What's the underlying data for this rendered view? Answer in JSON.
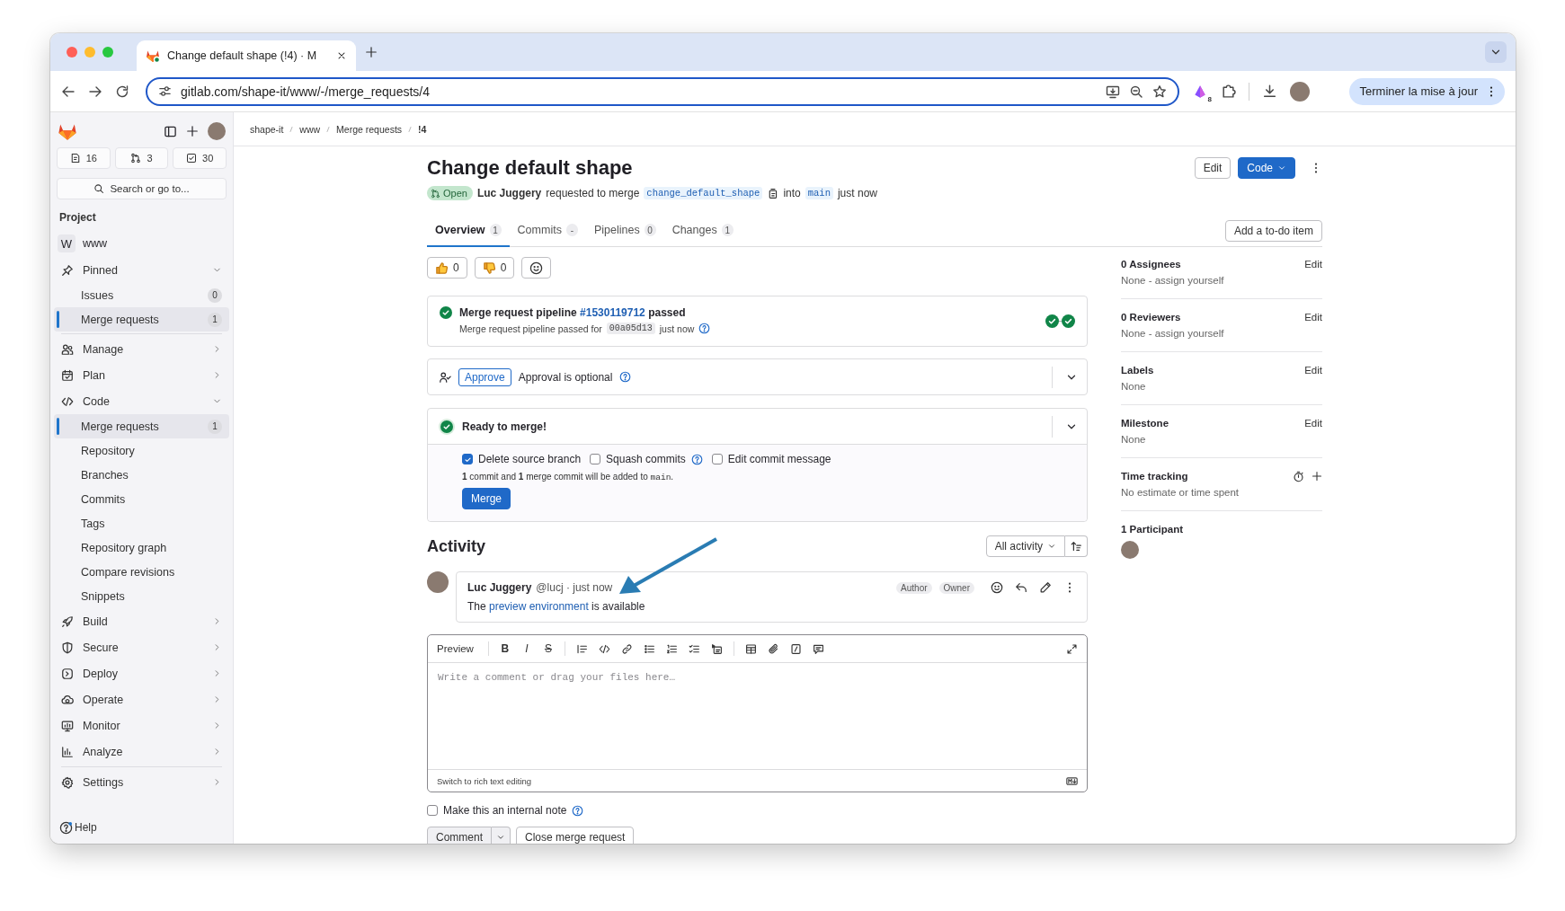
{
  "browser": {
    "tab_title": "Change default shape (!4) · M",
    "url": "gitlab.com/shape-it/www/-/merge_requests/4",
    "extension_badge": "8",
    "update_button": "Terminer la mise à jour"
  },
  "sidebar": {
    "counts": [
      {
        "count": "16"
      },
      {
        "count": "3"
      },
      {
        "count": "30"
      }
    ],
    "search": {
      "placeholder": "Search or go to..."
    },
    "section": "Project",
    "project": {
      "initial": "W",
      "name": "www"
    },
    "pinned": {
      "label": "Pinned",
      "expanded": true,
      "children": [
        {
          "label": "Issues",
          "count": "0",
          "selected": false
        },
        {
          "label": "Merge requests",
          "count": "1",
          "selected": true
        }
      ]
    },
    "nav": [
      {
        "label": "Manage",
        "expanded": false
      },
      {
        "label": "Plan",
        "expanded": false
      },
      {
        "label": "Code",
        "expanded": true,
        "children": [
          {
            "label": "Merge requests",
            "count": "1",
            "selected": true
          },
          {
            "label": "Repository",
            "selected": false
          },
          {
            "label": "Branches",
            "selected": false
          },
          {
            "label": "Commits",
            "selected": false
          },
          {
            "label": "Tags",
            "selected": false
          },
          {
            "label": "Repository graph",
            "selected": false
          },
          {
            "label": "Compare revisions",
            "selected": false
          },
          {
            "label": "Snippets",
            "selected": false
          }
        ]
      },
      {
        "label": "Build",
        "expanded": false
      },
      {
        "label": "Secure",
        "expanded": false
      },
      {
        "label": "Deploy",
        "expanded": false
      },
      {
        "label": "Operate",
        "expanded": false
      },
      {
        "label": "Monitor",
        "expanded": false
      },
      {
        "label": "Analyze",
        "expanded": false
      }
    ],
    "settings": {
      "label": "Settings",
      "expanded": false
    },
    "help": "Help"
  },
  "breadcrumb": [
    "shape-it",
    "www",
    "Merge requests",
    "!4"
  ],
  "header": {
    "title": "Change default shape",
    "edit_button": "Edit",
    "code_button": "Code",
    "status": "Open",
    "author": "Luc Juggery",
    "action": "requested to merge",
    "source_branch": "change_default_shape",
    "into": "into",
    "target_branch": "main",
    "time": "just now"
  },
  "tabs": [
    {
      "label": "Overview",
      "count": "1",
      "selected": true
    },
    {
      "label": "Commits",
      "count": "-",
      "selected": false
    },
    {
      "label": "Pipelines",
      "count": "0",
      "selected": false
    },
    {
      "label": "Changes",
      "count": "1",
      "selected": false
    }
  ],
  "todo_button": "Add a to-do item",
  "reactions": [
    {
      "count": "0"
    },
    {
      "count": "0"
    }
  ],
  "pipeline": {
    "before": "Merge request pipeline ",
    "link": "#1530119712",
    "after": " passed",
    "detail": "Merge request pipeline passed for",
    "commit": "00a05d13",
    "time": "just now"
  },
  "approval": {
    "button": "Approve",
    "text": "Approval is optional",
    "expanded": false
  },
  "merge": {
    "title": "Ready to merge!",
    "options": [
      {
        "label": "Delete source branch",
        "checked": true,
        "help": false
      },
      {
        "label": "Squash commits",
        "checked": false,
        "help": true
      },
      {
        "label": "Edit commit message",
        "checked": false,
        "help": false
      }
    ],
    "summary_before": "**1** commit and **1** merge commit will be added to",
    "summary_branch": "main",
    "summary_after": ".",
    "button": "Merge"
  },
  "activity": {
    "title": "Activity",
    "filter": "All activity",
    "comments": [
      {
        "author": "Luc Juggery",
        "meta": "@lucj · just now",
        "badges": [
          "Author",
          "Owner"
        ],
        "before": "The ",
        "link": "preview environment",
        "after": " is available"
      }
    ]
  },
  "editor": {
    "mode_button": "Preview",
    "format_buttons": [
      "B",
      "I",
      "S"
    ],
    "placeholder": "Write a comment or drag your files here…",
    "footer": "Switch to rich text editing"
  },
  "internal_note": {
    "label": "Make this an internal note",
    "checked": false
  },
  "actions": {
    "comment": "Comment",
    "close": "Close merge request"
  },
  "right_sidebar": {
    "sections": [
      {
        "kind": "editable",
        "title": "0 Assignees",
        "action": "Edit",
        "value": "None - assign yourself"
      },
      {
        "kind": "editable",
        "title": "0 Reviewers",
        "action": "Edit",
        "value": "None - assign yourself"
      },
      {
        "kind": "editable",
        "title": "Labels",
        "action": "Edit",
        "value": "None"
      },
      {
        "kind": "editable",
        "title": "Milestone",
        "action": "Edit",
        "value": "None"
      },
      {
        "kind": "time",
        "title": "Time tracking",
        "value": "No estimate or time spent"
      },
      {
        "kind": "participants",
        "title": "1 Participant"
      }
    ]
  }
}
